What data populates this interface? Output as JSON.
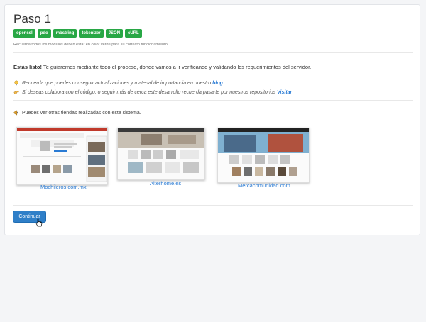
{
  "title": "Paso 1",
  "badges": [
    "openssl",
    "pdo",
    "mbstring",
    "tokenizer",
    "JSON",
    "cURL"
  ],
  "hint": "Recuerda todos los módulos deben estar en color verde para su correcto funcionamiento",
  "ready": {
    "bold": "Estás listo!",
    "text": " Te guiaremos mediante todo el proceso, donde vamos a ir verificando y validando los requerimientos del servidor."
  },
  "tips": [
    {
      "text": "Recuerda que puedes conseguir actualizaciones y material de importancia en nuestro ",
      "link": "blog",
      "icon": "lightbulb-icon"
    },
    {
      "text": "Si deseas colabora con el código, o seguir más de cerca este desarrollo recuerda pasarte por nuestros repositorios ",
      "link": "Visitar",
      "icon": "hand-pointing-icon"
    }
  ],
  "stores_label": "Puedes ver otras tiendas realizadas con este sistema.",
  "stores": [
    {
      "name": "Mochileros.com.mx"
    },
    {
      "name": "Alterhome.es"
    },
    {
      "name": "Mercacomunidad.com"
    }
  ],
  "continue_button": "Continuar",
  "colors": {
    "badge": "#28a745",
    "link": "#2a7bd4",
    "button": "#2f7fc8"
  }
}
